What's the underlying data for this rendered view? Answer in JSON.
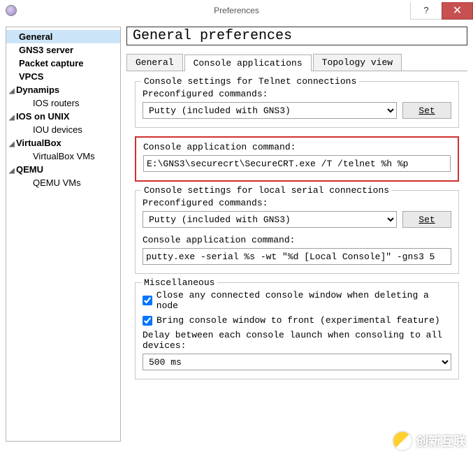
{
  "window": {
    "title": "Preferences"
  },
  "sidebar": {
    "items": [
      {
        "label": "General",
        "bold": true,
        "selected": true
      },
      {
        "label": "GNS3 server",
        "bold": true
      },
      {
        "label": "Packet capture",
        "bold": true
      },
      {
        "label": "VPCS",
        "bold": true
      },
      {
        "label": "Dynamips",
        "bold": true,
        "exp": true
      },
      {
        "label": "IOS routers",
        "sub": true
      },
      {
        "label": "IOS on UNIX",
        "bold": true,
        "exp": true
      },
      {
        "label": "IOU devices",
        "sub": true
      },
      {
        "label": "VirtualBox",
        "bold": true,
        "exp": true
      },
      {
        "label": "VirtualBox VMs",
        "sub": true
      },
      {
        "label": "QEMU",
        "bold": true,
        "exp": true
      },
      {
        "label": "QEMU VMs",
        "sub": true
      }
    ]
  },
  "heading": "General preferences",
  "tabs": [
    {
      "label": "General",
      "active": false
    },
    {
      "label": "Console applications",
      "active": true
    },
    {
      "label": "Topology view",
      "active": false
    }
  ],
  "telnet": {
    "title": "Console settings for Telnet connections",
    "pre_label": "Preconfigured commands:",
    "pre_value": "Putty (included with GNS3)",
    "set": "Set",
    "cmd_label": "Console application command:",
    "cmd_value": "E:\\GNS3\\securecrt\\SecureCRT.exe /T /telnet %h %p"
  },
  "serial": {
    "title": "Console settings for local serial connections",
    "pre_label": "Preconfigured commands:",
    "pre_value": "Putty (included with GNS3)",
    "set": "Set",
    "cmd_label": "Console application command:",
    "cmd_value": "putty.exe -serial %s -wt \"%d [Local Console]\" -gns3 5"
  },
  "misc": {
    "title": "Miscellaneous",
    "close_on_delete": "Close any connected console window when deleting a node",
    "bring_front": "Bring console window to front (experimental feature)",
    "delay_label": "Delay between each console launch when consoling to all devices:",
    "delay_value": "500 ms"
  },
  "watermark": "创新互联"
}
